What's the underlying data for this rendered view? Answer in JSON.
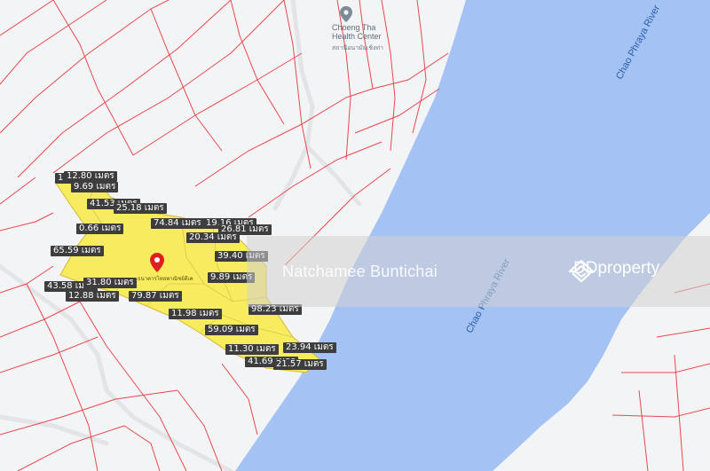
{
  "map": {
    "colors": {
      "land": "#f3f4f6",
      "water": "#a5c2f4",
      "parcel_line": "#e8484e",
      "highlight": "#f7ec5e",
      "road": "#e2e4e8",
      "pin": "#e02020"
    },
    "place": {
      "name": "Choeng Tha\nHealth Center",
      "thai": "สถานีอนามัยเชิงท่า",
      "icon": "map-pin-icon"
    },
    "rivers": [
      {
        "name": "Chao Phraya River"
      },
      {
        "name": "Chao Phraya River"
      }
    ],
    "parcel_name": "ธนาคารไทยพาณิชย์ดีเค",
    "watermark": {
      "name": "Natchamee Buntichai",
      "brand": "DDproperty",
      "icon": "ddproperty-logo-icon"
    },
    "labels": [
      "17.44 เมตร",
      "12.80 เมตร",
      "9.69 เมตร",
      "41.53 เมตร",
      "25.18 เมตร",
      "74.84 เมตร",
      "19.16 เมตร",
      "0.66 เมตร",
      "26.81 เมตร",
      "20.34 เมตร",
      "65.59 เมตร",
      "39.40 เมตร",
      "9.89 เมตร",
      "43.58 เมตร",
      "31.80 เมตร",
      "12.88 เมตร",
      "79.87 เมตร",
      "98.23 เมตร",
      "11.98 เมตร",
      "59.09 เมตร",
      "23.94 เมตร",
      "11.30 เมตร",
      "41.69 เมตร",
      "21.57 เมตร"
    ]
  }
}
